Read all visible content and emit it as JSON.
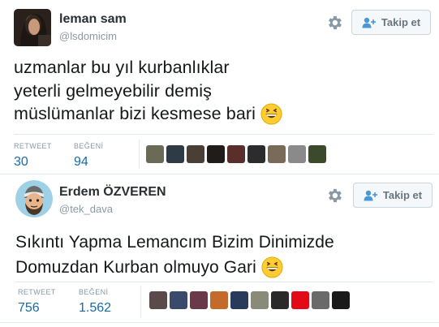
{
  "tweets": [
    {
      "user_name": "leman sam",
      "handle": "@lsdomicim",
      "follow_label": "Takip et",
      "text_lines": [
        "uzmanlar bu yıl kurbanlıklar",
        "yeterli gelmeyebilir demiş",
        "müslümanlar bizi kesmese bari"
      ],
      "retweet_label": "RETWEET",
      "retweet_count": "30",
      "like_label": "BEĞENİ",
      "like_count": "94",
      "liker_colors": [
        "#6b6a57",
        "#2e3a46",
        "#4a3f35",
        "#1f1c1a",
        "#5a2e2a",
        "#2c2b2e",
        "#7a6a5a",
        "#8a8a8a",
        "#3b4a2a"
      ]
    },
    {
      "user_name": "Erdem ÖZVEREN",
      "handle": "@tek_dava",
      "follow_label": "Takip et",
      "text_lines": [
        "Sıkıntı Yapma Lemancım Bizim Dinimizde",
        "Domuzdan Kurban olmuyo Gari"
      ],
      "retweet_label": "RETWEET",
      "retweet_count": "756",
      "like_label": "BEĞENİ",
      "like_count": "1.562",
      "liker_colors": [
        "#5a4a4a",
        "#3a4a6a",
        "#6a3a4a",
        "#c46a2a",
        "#2a3a5a",
        "#8a8a7a",
        "#2a2a2a",
        "#e30a17",
        "#6a6a6a",
        "#1a1a1a"
      ]
    }
  ]
}
